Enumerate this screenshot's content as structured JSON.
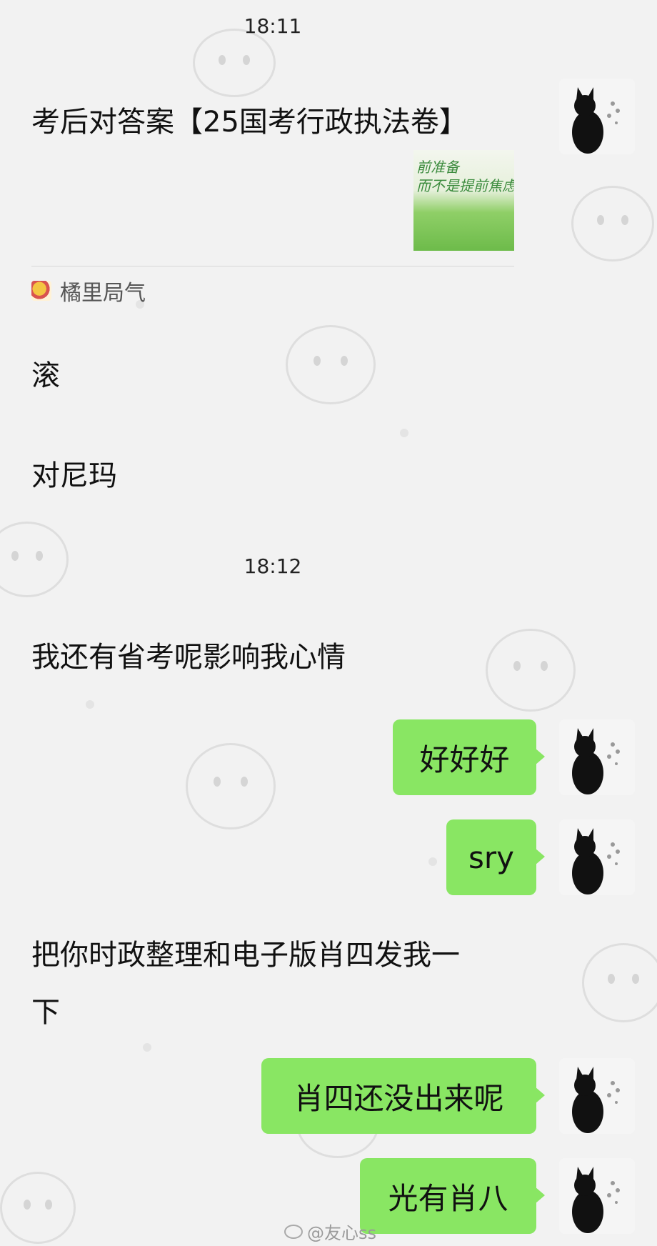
{
  "timestamps": [
    "18:11",
    "18:12"
  ],
  "quote": {
    "title": "考后对答案【25国考行政执法卷】",
    "thumbnail_text": [
      "前准备",
      "而不是提前焦虑"
    ],
    "source_name": "橘里局气"
  },
  "messages": {
    "m1": "滚",
    "m2": "对尼玛",
    "m3": "我还有省考呢影响我心情",
    "m4_line1": "把你时政整理和电子版肖四发我一",
    "m4_line2": "下"
  },
  "my_messages": {
    "r1": "好好好",
    "r2": "sry",
    "r3": "肖四还没出来呢",
    "r4": "光有肖八"
  },
  "watermark": "@友心ss",
  "colors": {
    "bubble": "#89e663",
    "background": "#f2f2f2"
  }
}
